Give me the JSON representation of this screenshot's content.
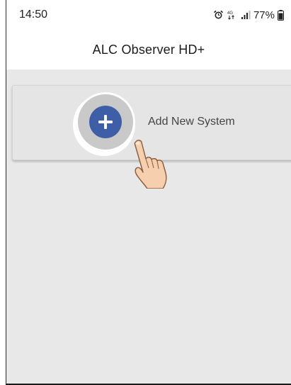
{
  "status_bar": {
    "time": "14:50",
    "network": "4G",
    "battery": "77%",
    "icons": [
      "alarm-icon",
      "network-4g-icon",
      "signal-icon",
      "battery-icon"
    ]
  },
  "app_bar": {
    "title": "ALC Observer HD+"
  },
  "main": {
    "add_system_label": "Add New System",
    "add_button_icon": "plus-icon"
  },
  "colors": {
    "accent": "#3f5ea8",
    "background": "#e8e8e8",
    "card": "#e5e5e5"
  }
}
